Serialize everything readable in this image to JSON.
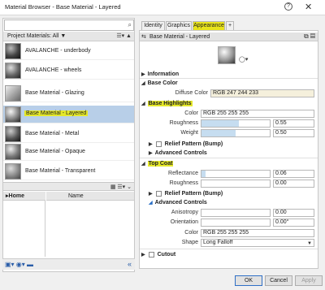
{
  "window": {
    "title": "Material Browser - Base Material - Layered"
  },
  "library": {
    "header_label": "Project Materials: All",
    "materials": [
      {
        "name": "AVALANCHE - underbody",
        "selected": false
      },
      {
        "name": "AVALANCHE - wheels",
        "selected": false
      },
      {
        "name": "Base Material - Glazing",
        "selected": false
      },
      {
        "name": "Base Material - Layered",
        "selected": true
      },
      {
        "name": "Base Material - Metal",
        "selected": false
      },
      {
        "name": "Base Material - Opaque",
        "selected": false
      },
      {
        "name": "Base Material - Transparent",
        "selected": false
      }
    ],
    "tree_header": "Home",
    "name_header": "Name"
  },
  "editor": {
    "tabs": [
      "Identity",
      "Graphics",
      "Appearance",
      "+"
    ],
    "active_tab": "Appearance",
    "material_name": "Base Material - Layered",
    "sections": {
      "information": "Information",
      "base_color": "Base Color",
      "base_highlights": "Base Highlights",
      "relief_pattern_1": "Relief Pattern (Bump)",
      "advanced_controls_1": "Advanced Controls",
      "top_coat": "Top Coat",
      "relief_pattern_2": "Relief Pattern (Bump)",
      "advanced_controls_2": "Advanced Controls",
      "cutout": "Cutout"
    },
    "diffuse_color": {
      "label": "Diffuse Color",
      "value": "RGB 247 244 233"
    },
    "highlights": {
      "color_label": "Color",
      "color_value": "RGB 255 255 255",
      "roughness_label": "Roughness",
      "roughness_value": "0.55",
      "roughness_level": 0.55,
      "weight_label": "Weight",
      "weight_value": "0.50",
      "weight_level": 0.5
    },
    "topcoat": {
      "reflectance_label": "Reflectance",
      "reflectance_value": "0.06",
      "reflectance_level": 0.06,
      "roughness_label": "Roughness",
      "roughness_value": "0.00",
      "roughness_level": 0.0
    },
    "advanced": {
      "anisotropy_label": "Anisotropy",
      "anisotropy_value": "0.00",
      "anisotropy_level": 0.0,
      "orientation_label": "Orientation",
      "orientation_value": "0.00°",
      "orientation_level": 0.0,
      "color_label": "Color",
      "color_value": "RGB 255 255 255",
      "shape_label": "Shape",
      "shape_value": "Long Falloff"
    }
  },
  "buttons": {
    "ok": "OK",
    "cancel": "Cancel",
    "apply": "Apply"
  },
  "colors": {
    "highlight": "#e5e82a",
    "selection": "#b8cfe8",
    "slider_fill": "#c6ddf0",
    "diffuse_field": "#f5f0dc"
  }
}
